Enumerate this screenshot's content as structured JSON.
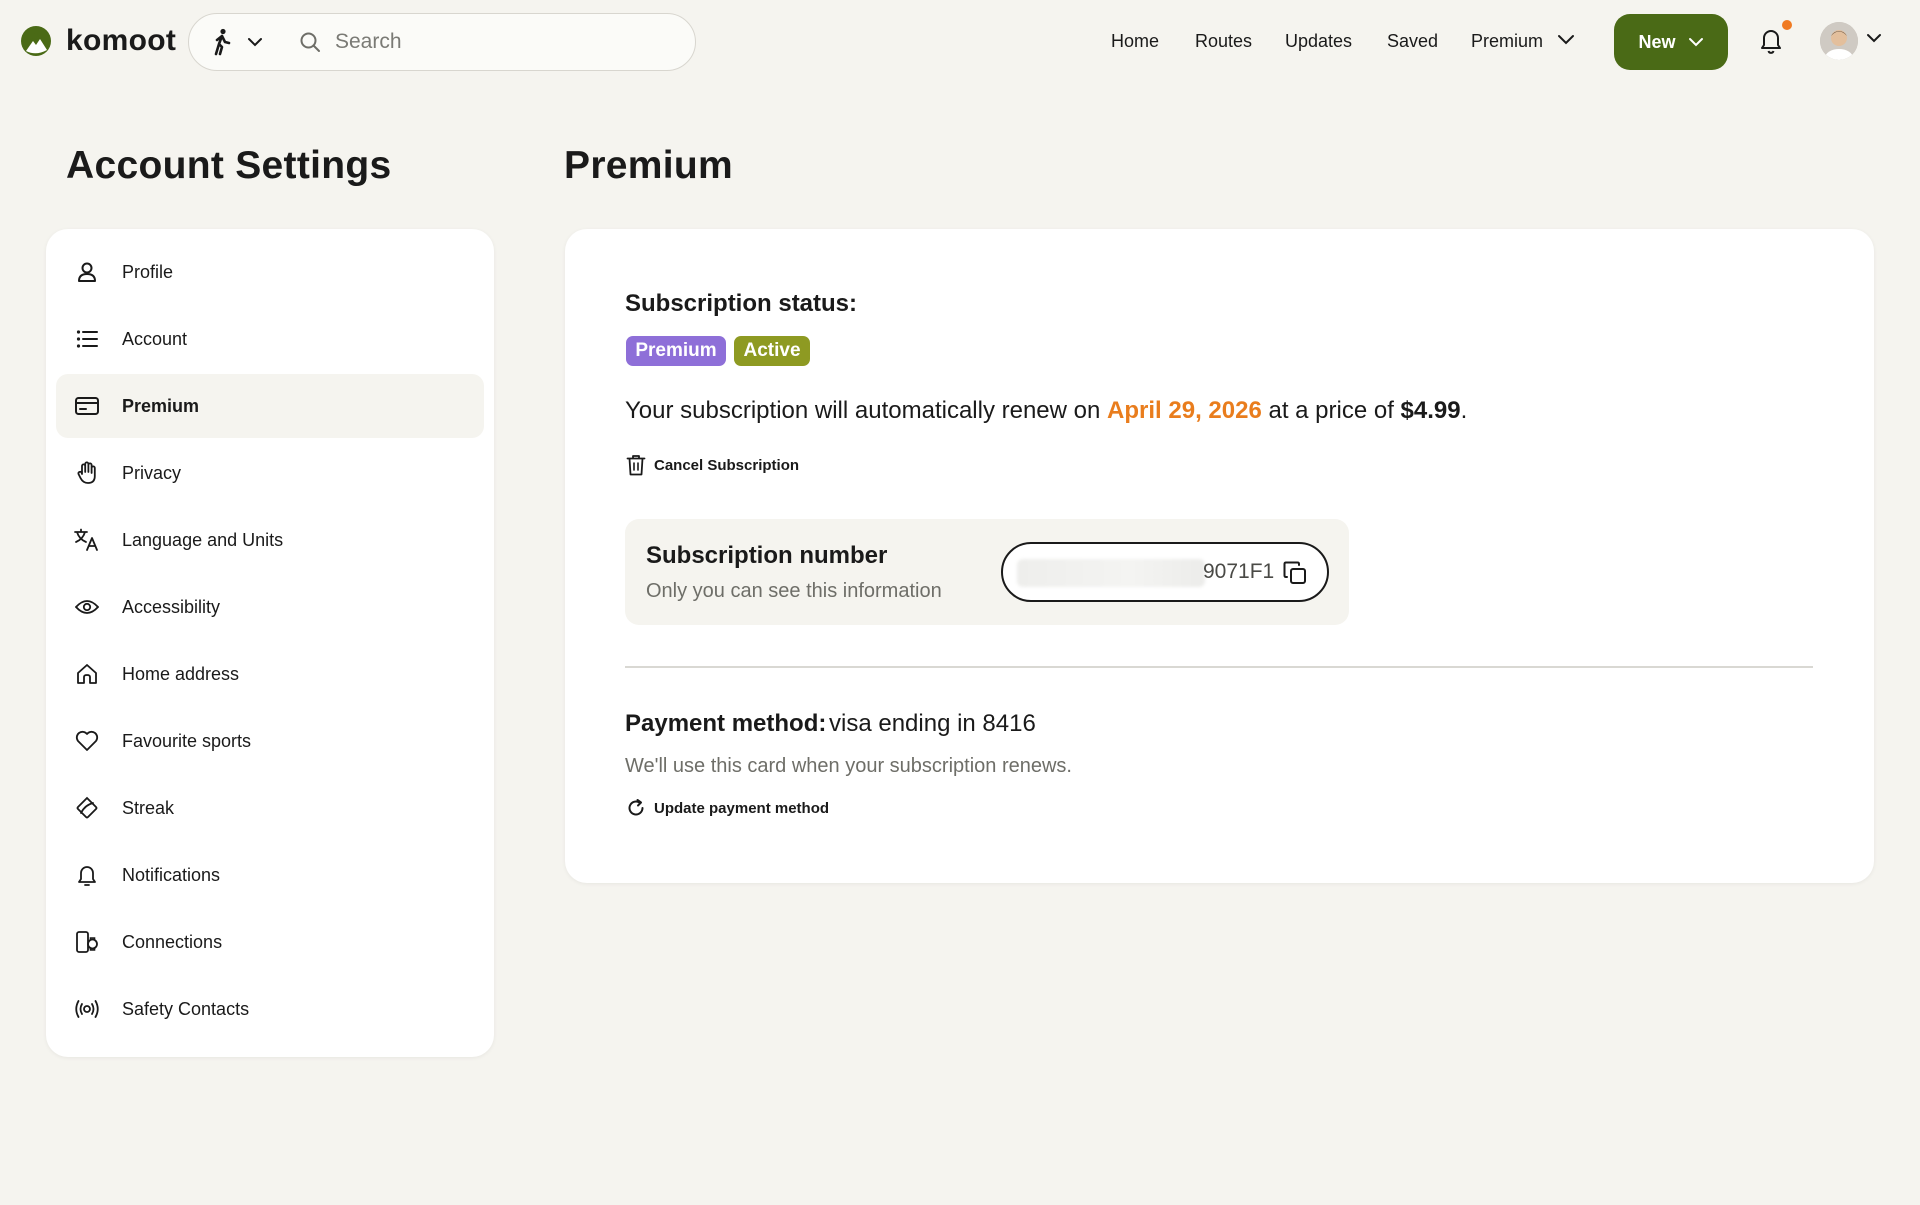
{
  "app": {
    "logo_text": "komoot",
    "brand_color": "#4a6a16",
    "accent_color": "#e97d1d"
  },
  "topbar": {
    "sport_icon": "hiking-icon",
    "search_placeholder": "Search",
    "nav": {
      "home": "Home",
      "routes": "Routes",
      "updates": "Updates",
      "saved": "Saved",
      "premium": "Premium"
    },
    "new_button": "New"
  },
  "sidebar": {
    "title": "Account Settings",
    "items": [
      {
        "label": "Profile",
        "icon": "person-icon"
      },
      {
        "label": "Account",
        "icon": "list-icon"
      },
      {
        "label": "Premium",
        "icon": "card-icon",
        "active": true
      },
      {
        "label": "Privacy",
        "icon": "hand-icon"
      },
      {
        "label": "Language and Units",
        "icon": "translate-icon"
      },
      {
        "label": "Accessibility",
        "icon": "eye-icon"
      },
      {
        "label": "Home address",
        "icon": "home-icon"
      },
      {
        "label": "Favourite sports",
        "icon": "heart-icon"
      },
      {
        "label": "Streak",
        "icon": "streak-icon"
      },
      {
        "label": "Notifications",
        "icon": "bell-icon"
      },
      {
        "label": "Connections",
        "icon": "devices-icon"
      },
      {
        "label": "Safety Contacts",
        "icon": "broadcast-icon"
      }
    ]
  },
  "main": {
    "title": "Premium",
    "subscription_status_label": "Subscription status:",
    "badges": {
      "plan": "Premium",
      "status": "Active",
      "plan_color": "#8e6fd8",
      "status_color": "#8e9a22"
    },
    "renewal": {
      "prefix": "Your subscription will automatically renew on",
      "date": "April 29, 2026",
      "middle": "at a price of",
      "price": "$4.99",
      "suffix": "."
    },
    "cancel_label": "Cancel Subscription",
    "subscription_number": {
      "title": "Subscription number",
      "subtitle": "Only you can see this information",
      "visible_suffix": "9071F1"
    },
    "payment": {
      "label": "Payment method:",
      "value": "visa ending in 8416",
      "note": "We'll use this card when your subscription renews.",
      "update_label": "Update payment method"
    }
  }
}
